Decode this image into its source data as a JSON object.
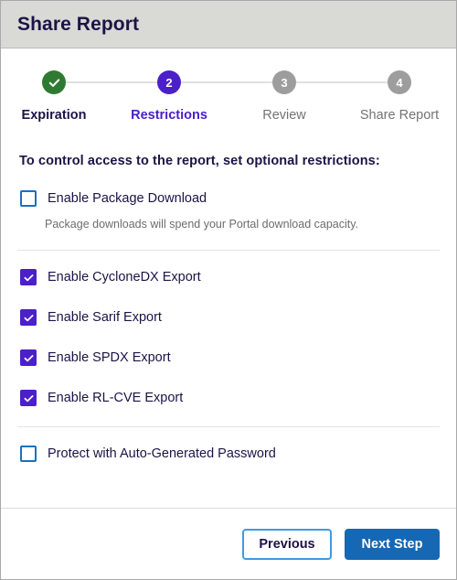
{
  "dialog": {
    "title": "Share Report"
  },
  "stepper": {
    "steps": [
      {
        "number": "1",
        "label": "Expiration",
        "state": "done",
        "icon": "check-icon"
      },
      {
        "number": "2",
        "label": "Restrictions",
        "state": "current"
      },
      {
        "number": "3",
        "label": "Review",
        "state": "upcoming"
      },
      {
        "number": "4",
        "label": "Share Report",
        "state": "upcoming"
      }
    ]
  },
  "body": {
    "heading": "To control access to the report, set optional restrictions:",
    "package_download": {
      "label": "Enable Package Download",
      "checked": false,
      "helper": "Package downloads will spend your Portal download capacity."
    },
    "exports": [
      {
        "label": "Enable CycloneDX Export",
        "checked": true
      },
      {
        "label": "Enable Sarif Export",
        "checked": true
      },
      {
        "label": "Enable SPDX Export",
        "checked": true
      },
      {
        "label": "Enable RL-CVE Export",
        "checked": true
      }
    ],
    "password": {
      "label": "Protect with Auto-Generated Password",
      "checked": false
    }
  },
  "footer": {
    "previous_label": "Previous",
    "next_label": "Next Step"
  },
  "colors": {
    "header_bg": "#d9d9d6",
    "title_text": "#1b1446",
    "accent_purple": "#4b20c8",
    "step_done_green": "#2e7a32",
    "step_upcoming_gray": "#9d9d9d",
    "checkbox_blue": "#1a6fc4",
    "primary_button_blue": "#1668b4",
    "secondary_border_blue": "#3f9ae5"
  }
}
